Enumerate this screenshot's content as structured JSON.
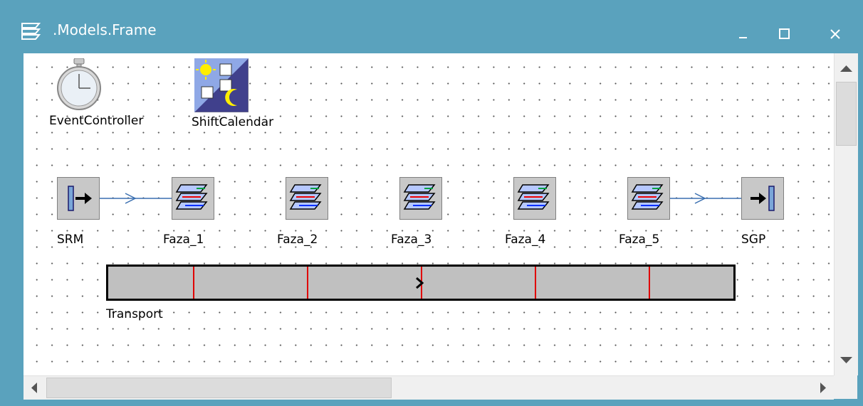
{
  "window": {
    "title": ".Models.Frame",
    "minimize_icon": "minimize-icon",
    "maximize_icon": "maximize-icon",
    "close_icon": "close-icon"
  },
  "objects": {
    "event_controller": {
      "label": "EventController",
      "icon": "stopwatch-icon"
    },
    "shift_calendar": {
      "label": "ShiftCalendar",
      "icon": "calendar-icon"
    },
    "source": {
      "label": "SRM",
      "icon": "source-icon"
    },
    "stations": [
      {
        "label": "Faza_1",
        "icon": "frame-icon"
      },
      {
        "label": "Faza_2",
        "icon": "frame-icon"
      },
      {
        "label": "Faza_3",
        "icon": "frame-icon"
      },
      {
        "label": "Faza_4",
        "icon": "frame-icon"
      },
      {
        "label": "Faza_5",
        "icon": "frame-icon"
      }
    ],
    "drain": {
      "label": "SGP",
      "icon": "drain-icon"
    },
    "transport": {
      "label": "Transport",
      "divider_color": "#e00000"
    }
  },
  "colors": {
    "titlebar": "#5aa2bd",
    "connector": "#3a6fb0"
  }
}
